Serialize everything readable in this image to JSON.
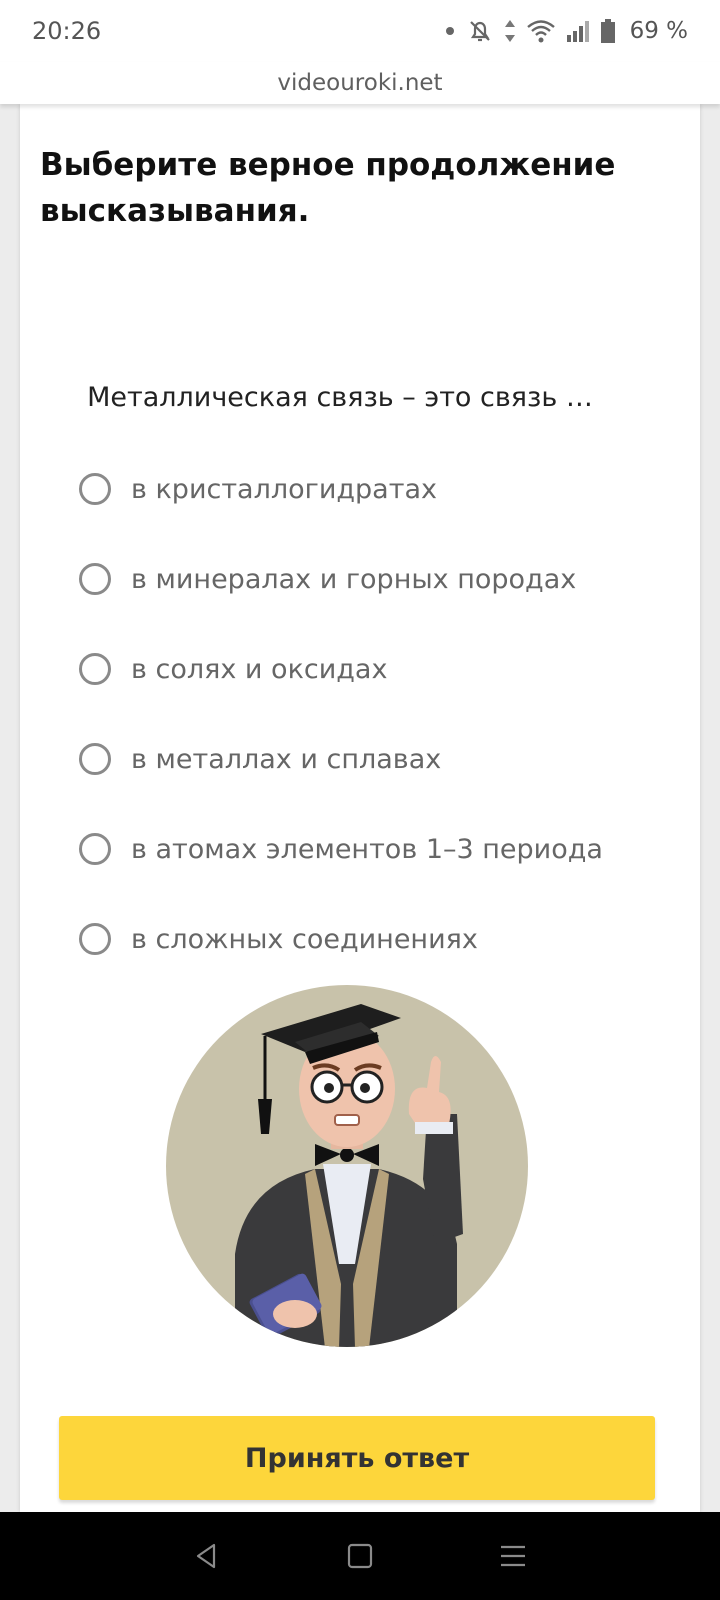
{
  "status_bar": {
    "time": "20:26",
    "battery": "69 %",
    "icons": [
      "notification-dot-icon",
      "bell-off-icon",
      "data-arrows-icon",
      "wifi-icon",
      "signal-icon",
      "battery-icon"
    ]
  },
  "browser": {
    "url": "videouroki.net"
  },
  "quiz": {
    "title": "Выберите верное продолжение высказывания.",
    "question": "Металлическая связь – это связь …",
    "options": [
      {
        "label": "в кристаллогидратах",
        "selected": false
      },
      {
        "label": "в минералах и горных породах",
        "selected": false
      },
      {
        "label": "в солях и оксидах",
        "selected": false
      },
      {
        "label": "в металлах и сплавах",
        "selected": false
      },
      {
        "label": "в атомах элементов 1–3 периода",
        "selected": false
      },
      {
        "label": "в сложных соединениях",
        "selected": false
      }
    ],
    "submit_label": "Принять ответ"
  },
  "colors": {
    "accent": "#fdd63b",
    "illustration_bg": "#c8c2aa",
    "radio_border": "#8a8a8a"
  },
  "nav": {
    "buttons": [
      "back-icon",
      "home-icon",
      "recents-icon"
    ]
  }
}
